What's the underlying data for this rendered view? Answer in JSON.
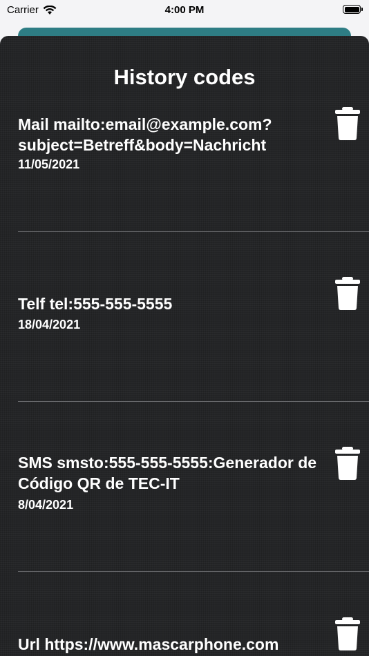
{
  "status_bar": {
    "carrier": "Carrier",
    "time": "4:00 PM",
    "icons": [
      "wifi-icon",
      "battery-icon"
    ]
  },
  "sheet": {
    "title": "History codes"
  },
  "history": [
    {
      "text": "Mail mailto:email@example.com?subject=Betreff&body=Nachricht",
      "date": "11/05/2021"
    },
    {
      "text": "Telf tel:555-555-5555",
      "date": "18/04/2021"
    },
    {
      "text": "SMS smsto:555-555-5555:Generador de Código QR de TEC-IT",
      "date": "8/04/2021"
    },
    {
      "text": "Url https://www.mascarphone.com",
      "date": ""
    }
  ],
  "icons": {
    "delete": "trash-icon"
  },
  "colors": {
    "background": "#242527",
    "accent": "#2e7d84",
    "text": "#ffffff",
    "divider": "#6a6b6e"
  }
}
